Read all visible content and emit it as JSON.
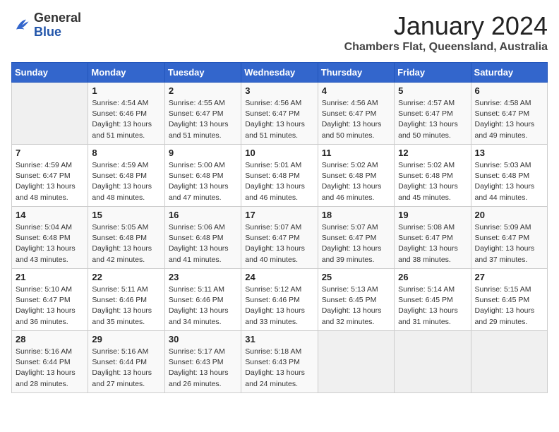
{
  "header": {
    "logo_line1": "General",
    "logo_line2": "Blue",
    "month": "January 2024",
    "location": "Chambers Flat, Queensland, Australia"
  },
  "days_of_week": [
    "Sunday",
    "Monday",
    "Tuesday",
    "Wednesday",
    "Thursday",
    "Friday",
    "Saturday"
  ],
  "weeks": [
    [
      {
        "day": null,
        "num": null
      },
      {
        "day": 1,
        "sunrise": "4:54 AM",
        "sunset": "6:46 PM",
        "daylight": "13 hours and 51 minutes."
      },
      {
        "day": 2,
        "sunrise": "4:55 AM",
        "sunset": "6:47 PM",
        "daylight": "13 hours and 51 minutes."
      },
      {
        "day": 3,
        "sunrise": "4:56 AM",
        "sunset": "6:47 PM",
        "daylight": "13 hours and 51 minutes."
      },
      {
        "day": 4,
        "sunrise": "4:56 AM",
        "sunset": "6:47 PM",
        "daylight": "13 hours and 50 minutes."
      },
      {
        "day": 5,
        "sunrise": "4:57 AM",
        "sunset": "6:47 PM",
        "daylight": "13 hours and 50 minutes."
      },
      {
        "day": 6,
        "sunrise": "4:58 AM",
        "sunset": "6:47 PM",
        "daylight": "13 hours and 49 minutes."
      }
    ],
    [
      {
        "day": 7,
        "sunrise": "4:59 AM",
        "sunset": "6:47 PM",
        "daylight": "13 hours and 48 minutes."
      },
      {
        "day": 8,
        "sunrise": "4:59 AM",
        "sunset": "6:48 PM",
        "daylight": "13 hours and 48 minutes."
      },
      {
        "day": 9,
        "sunrise": "5:00 AM",
        "sunset": "6:48 PM",
        "daylight": "13 hours and 47 minutes."
      },
      {
        "day": 10,
        "sunrise": "5:01 AM",
        "sunset": "6:48 PM",
        "daylight": "13 hours and 46 minutes."
      },
      {
        "day": 11,
        "sunrise": "5:02 AM",
        "sunset": "6:48 PM",
        "daylight": "13 hours and 46 minutes."
      },
      {
        "day": 12,
        "sunrise": "5:02 AM",
        "sunset": "6:48 PM",
        "daylight": "13 hours and 45 minutes."
      },
      {
        "day": 13,
        "sunrise": "5:03 AM",
        "sunset": "6:48 PM",
        "daylight": "13 hours and 44 minutes."
      }
    ],
    [
      {
        "day": 14,
        "sunrise": "5:04 AM",
        "sunset": "6:48 PM",
        "daylight": "13 hours and 43 minutes."
      },
      {
        "day": 15,
        "sunrise": "5:05 AM",
        "sunset": "6:48 PM",
        "daylight": "13 hours and 42 minutes."
      },
      {
        "day": 16,
        "sunrise": "5:06 AM",
        "sunset": "6:48 PM",
        "daylight": "13 hours and 41 minutes."
      },
      {
        "day": 17,
        "sunrise": "5:07 AM",
        "sunset": "6:47 PM",
        "daylight": "13 hours and 40 minutes."
      },
      {
        "day": 18,
        "sunrise": "5:07 AM",
        "sunset": "6:47 PM",
        "daylight": "13 hours and 39 minutes."
      },
      {
        "day": 19,
        "sunrise": "5:08 AM",
        "sunset": "6:47 PM",
        "daylight": "13 hours and 38 minutes."
      },
      {
        "day": 20,
        "sunrise": "5:09 AM",
        "sunset": "6:47 PM",
        "daylight": "13 hours and 37 minutes."
      }
    ],
    [
      {
        "day": 21,
        "sunrise": "5:10 AM",
        "sunset": "6:47 PM",
        "daylight": "13 hours and 36 minutes."
      },
      {
        "day": 22,
        "sunrise": "5:11 AM",
        "sunset": "6:46 PM",
        "daylight": "13 hours and 35 minutes."
      },
      {
        "day": 23,
        "sunrise": "5:11 AM",
        "sunset": "6:46 PM",
        "daylight": "13 hours and 34 minutes."
      },
      {
        "day": 24,
        "sunrise": "5:12 AM",
        "sunset": "6:46 PM",
        "daylight": "13 hours and 33 minutes."
      },
      {
        "day": 25,
        "sunrise": "5:13 AM",
        "sunset": "6:45 PM",
        "daylight": "13 hours and 32 minutes."
      },
      {
        "day": 26,
        "sunrise": "5:14 AM",
        "sunset": "6:45 PM",
        "daylight": "13 hours and 31 minutes."
      },
      {
        "day": 27,
        "sunrise": "5:15 AM",
        "sunset": "6:45 PM",
        "daylight": "13 hours and 29 minutes."
      }
    ],
    [
      {
        "day": 28,
        "sunrise": "5:16 AM",
        "sunset": "6:44 PM",
        "daylight": "13 hours and 28 minutes."
      },
      {
        "day": 29,
        "sunrise": "5:16 AM",
        "sunset": "6:44 PM",
        "daylight": "13 hours and 27 minutes."
      },
      {
        "day": 30,
        "sunrise": "5:17 AM",
        "sunset": "6:43 PM",
        "daylight": "13 hours and 26 minutes."
      },
      {
        "day": 31,
        "sunrise": "5:18 AM",
        "sunset": "6:43 PM",
        "daylight": "13 hours and 24 minutes."
      },
      {
        "day": null
      },
      {
        "day": null
      },
      {
        "day": null
      }
    ]
  ]
}
